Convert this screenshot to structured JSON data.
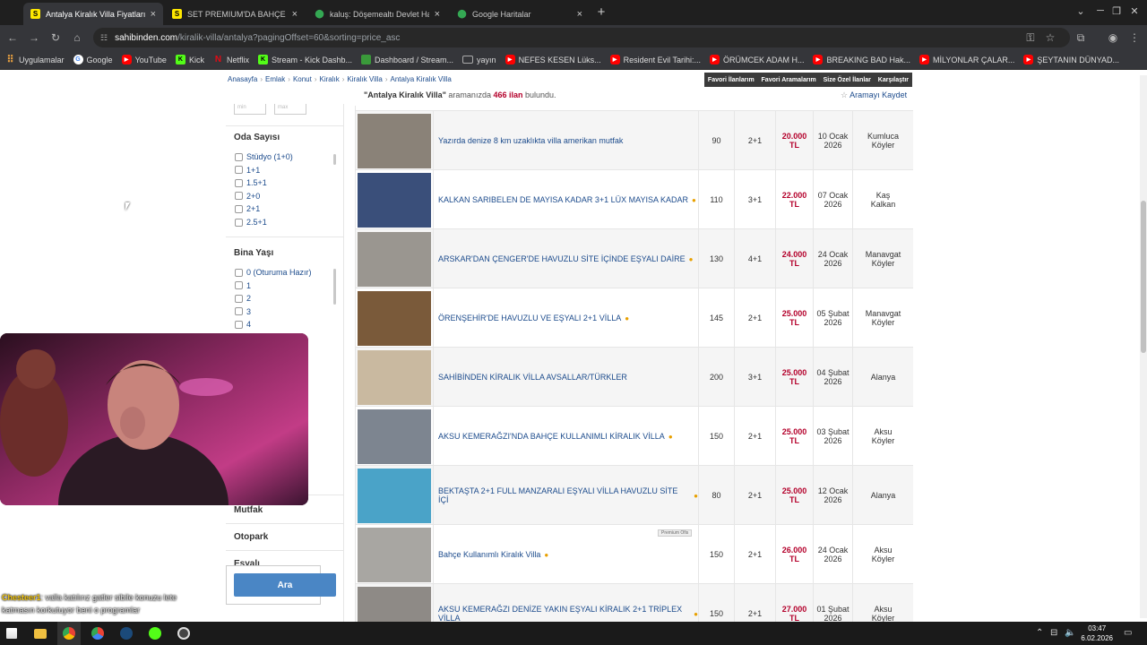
{
  "browser": {
    "tabs": [
      {
        "title": "Antalya Kiralık Villa Fiyatları sah",
        "icon": "sahibinden-icon",
        "active": true
      },
      {
        "title": "SET PREMIUM'DA BAHÇE KULL",
        "icon": "sahibinden-icon",
        "active": false
      },
      {
        "title": "kaluş: Döşemealtı Devlet Hasta",
        "icon": "maps-pin-icon",
        "active": false
      },
      {
        "title": "Google Haritalar",
        "icon": "maps-pin-icon",
        "active": false
      }
    ],
    "url_host": "sahibinden.com",
    "url_path": "/kiralik-villa/antalya?pagingOffset=60&sorting=price_asc",
    "bookmarks": [
      {
        "label": "Uygulamalar",
        "icon": "apps-grid-icon",
        "color": "#d9534f"
      },
      {
        "label": "Google",
        "icon": "google-icon",
        "color": "#4285f4"
      },
      {
        "label": "YouTube",
        "icon": "youtube-icon",
        "color": "#ff0000"
      },
      {
        "label": "Kick",
        "icon": "kick-icon",
        "color": "#53fc18"
      },
      {
        "label": "Netflix",
        "icon": "netflix-icon",
        "color": "#e50914"
      },
      {
        "label": "Stream - Kick Dashb...",
        "icon": "kick-icon",
        "color": "#53fc18"
      },
      {
        "label": "Dashboard / Stream...",
        "icon": "dashboard-icon",
        "color": "#3a9a3a"
      },
      {
        "label": "yayın",
        "icon": "folder-icon",
        "color": "#9a9a9a"
      },
      {
        "label": "NEFES KESEN Lüks...",
        "icon": "youtube-icon",
        "color": "#ff0000"
      },
      {
        "label": "Resident Evil Tarihi:...",
        "icon": "youtube-icon",
        "color": "#ff0000"
      },
      {
        "label": "ÖRÜMCEK ADAM H...",
        "icon": "youtube-icon",
        "color": "#ff0000"
      },
      {
        "label": "BREAKING BAD Hak...",
        "icon": "youtube-icon",
        "color": "#ff0000"
      },
      {
        "label": "MİLYONLAR ÇALAR...",
        "icon": "youtube-icon",
        "color": "#ff0000"
      },
      {
        "label": "ŞEYTANIN DÜNYAD...",
        "icon": "youtube-icon",
        "color": "#ff0000"
      }
    ]
  },
  "breadcrumb": [
    "Anasayfa",
    "Emlak",
    "Konut",
    "Kiralık",
    "Kiralık Villa",
    "Antalya Kiralık Villa"
  ],
  "topbar": [
    "Favori İlanlarım",
    "Favori Aramalarım",
    "Size Özel İlanlar",
    "Karşılaştır"
  ],
  "search_info": {
    "query": "\"Antalya Kiralık Villa\"",
    "middle": " aramanızda ",
    "count": "466 ilan",
    "suffix": " bulundu."
  },
  "save_search": "Aramayı Kaydet",
  "sidebar": {
    "mini_inputs": [
      "min",
      "max"
    ],
    "room_title": "Oda Sayısı",
    "room_options": [
      "Stüdyo (1+0)",
      "1+1",
      "1.5+1",
      "2+0",
      "2+1",
      "2.5+1"
    ],
    "age_title": "Bina Yaşı",
    "age_options": [
      "0 (Oturuma Hazır)",
      "1",
      "2",
      "3",
      "4"
    ],
    "sections": [
      "Mutfak",
      "Otopark",
      "Eşyalı"
    ],
    "search_button": "Ara"
  },
  "listings": [
    {
      "title": "Yazırda denize 8 km uzaklıkta villa amerikan mutfak",
      "m2": "90",
      "rooms": "2+1",
      "price": "20.000 TL",
      "date": [
        "10 Ocak",
        "2026"
      ],
      "loc": [
        "Kumluca",
        "Köyler"
      ],
      "thumb": "#8a8278",
      "pin": false
    },
    {
      "title": "KALKAN SARIBELEN DE MAYISA KADAR 3+1 LÜX MAYISA KADAR",
      "m2": "110",
      "rooms": "3+1",
      "price": "22.000 TL",
      "date": [
        "07 Ocak",
        "2026"
      ],
      "loc": [
        "Kaş",
        "Kalkan"
      ],
      "thumb": "#3a4f7a",
      "pin": true
    },
    {
      "title": "ARSKAR'DAN ÇENGER'DE HAVUZLU SİTE İÇİNDE EŞYALI DAİRE",
      "m2": "130",
      "rooms": "4+1",
      "price": "24.000 TL",
      "date": [
        "24 Ocak",
        "2026"
      ],
      "loc": [
        "Manavgat",
        "Köyler"
      ],
      "thumb": "#9a9690",
      "pin": true
    },
    {
      "title": "ÖRENŞEHİR'DE HAVUZLU VE EŞYALI 2+1 VİLLA",
      "m2": "145",
      "rooms": "2+1",
      "price": "25.000 TL",
      "date": [
        "05 Şubat",
        "2026"
      ],
      "loc": [
        "Manavgat",
        "Köyler"
      ],
      "thumb": "#7a5a3a",
      "pin": true
    },
    {
      "title": "SAHİBİNDEN KİRALIK VİLLA AVSALLAR/TÜRKLER",
      "m2": "200",
      "rooms": "3+1",
      "price": "25.000 TL",
      "date": [
        "04 Şubat",
        "2026"
      ],
      "loc": [
        "Alanya"
      ],
      "thumb": "#c9b9a0",
      "pin": false
    },
    {
      "title": "AKSU KEMERAĞZI'NDA BAHÇE KULLANIMLI KİRALIK VİLLA",
      "m2": "150",
      "rooms": "2+1",
      "price": "25.000 TL",
      "date": [
        "03 Şubat",
        "2026"
      ],
      "loc": [
        "Aksu",
        "Köyler"
      ],
      "thumb": "#7d8590",
      "pin": true
    },
    {
      "title": "BEKTAŞTA 2+1 FULL MANZARALI EŞYALI VİLLA HAVUZLU SİTE İÇİ",
      "m2": "80",
      "rooms": "2+1",
      "price": "25.000 TL",
      "date": [
        "12 Ocak",
        "2026"
      ],
      "loc": [
        "Alanya"
      ],
      "thumb": "#4aa3c8",
      "pin": true
    },
    {
      "title": "Bahçe Kullanımlı Kiralık Villa",
      "m2": "150",
      "rooms": "2+1",
      "price": "26.000 TL",
      "date": [
        "24 Ocak",
        "2026"
      ],
      "loc": [
        "Aksu",
        "Köyler"
      ],
      "thumb": "#a8a6a2",
      "pin": true
    },
    {
      "title": "AKSU KEMERAĞZI DENİZE YAKIN EŞYALI KİRALIK 2+1 TRİPLEX VİLLA",
      "m2": "150",
      "rooms": "2+1",
      "price": "27.000 TL",
      "date": [
        "01 Şubat",
        "2026"
      ],
      "loc": [
        "Aksu",
        "Köyler"
      ],
      "thumb": "#8e8a86",
      "pin": true
    }
  ],
  "premium_badge": "Premium Ofis",
  "chat": {
    "user": "Chesteer1",
    "line1": ": valla katılırız gatler sibile konuzu lete",
    "line2": "katmasın korkutuyor beni o programlar"
  },
  "clock": {
    "time": "03:47",
    "date": "6.02.2026"
  }
}
